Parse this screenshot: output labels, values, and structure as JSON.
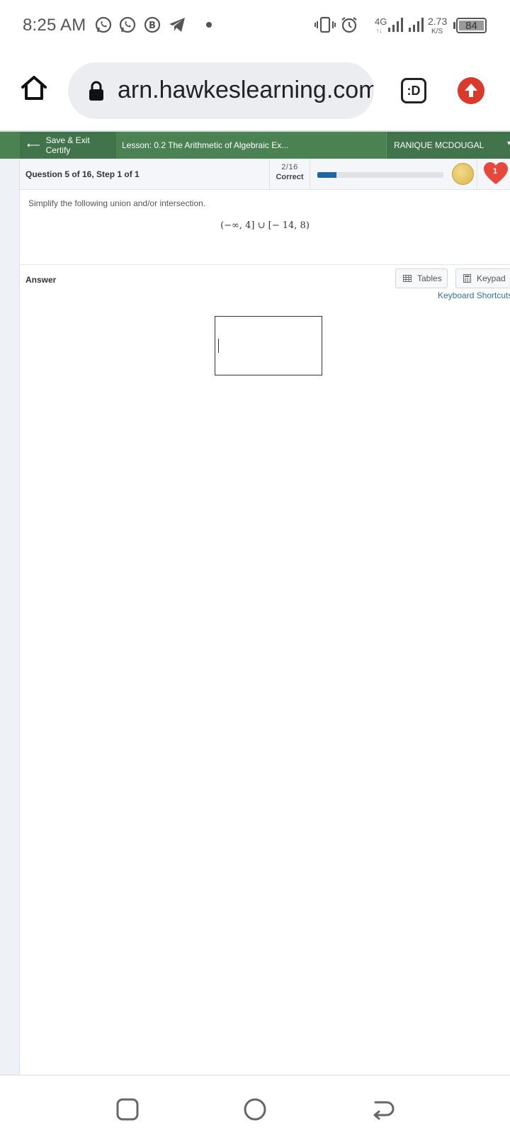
{
  "status_bar": {
    "time": "8:25 AM",
    "network_type": "4G",
    "network_sub": "↑↓",
    "speed_value": "2.73",
    "speed_unit": "K/S",
    "battery": "84",
    "icons": [
      "whatsapp-icon",
      "whatsapp-business-icon",
      "b-app-icon",
      "telegram-icon",
      "vibrate-icon",
      "alarm-icon",
      "signal-icon",
      "signal-icon-2",
      "battery-icon"
    ]
  },
  "browser": {
    "url": "arn.hawkeslearning.com",
    "tab_switcher_label": ":D",
    "icons": [
      "home-icon",
      "lock-icon",
      "update-icon"
    ]
  },
  "header": {
    "save_exit_label": "Save & Exit Certify",
    "lesson_title": "Lesson: 0.2 The Arithmetic of Algebraic Ex...",
    "user_name": "RANIQUE MCDOUGAL"
  },
  "question": {
    "title": "Question 5 of 16, Step 1 of 1",
    "score_fraction": "2/16",
    "score_label": "Correct",
    "progress_fraction": 0.15,
    "hearts": "1",
    "prompt": "Simplify the following union and/or intersection.",
    "expression": "(−∞, 4] ∪ [− 14, 8)"
  },
  "answer": {
    "label": "Answer",
    "tables_label": "Tables",
    "keypad_label": "Keypad",
    "keyboard_shortcuts_label": "Keyboard Shortcuts",
    "input_value": ""
  },
  "colors": {
    "header_green": "#4a8253",
    "header_green_dark": "#41744a",
    "progress_blue": "#1d64a8",
    "heart_red": "#e8473d",
    "link_blue": "#2e6fa3"
  }
}
